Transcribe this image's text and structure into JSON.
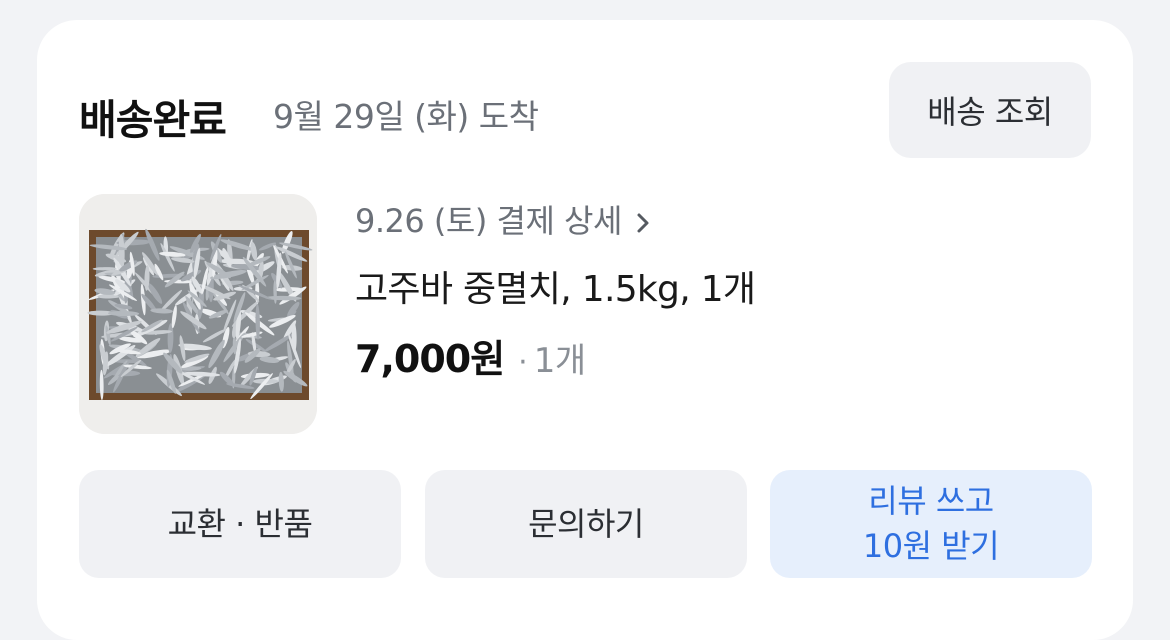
{
  "order": {
    "status": "배송완료",
    "arrival": "9월 29일 (화) 도착",
    "track_button": "배송 조회",
    "payment_detail_link": "9.26 (토) 결제 상세",
    "product_name": "고주바 중멸치, 1.5kg, 1개",
    "price": "7,000원",
    "separator": "·",
    "quantity": "1개"
  },
  "actions": {
    "exchange_return": "교환 · 반품",
    "inquiry": "문의하기",
    "review_line1": "리뷰 쓰고",
    "review_line2": "10원 받기"
  },
  "icons": {
    "payment_detail": "chevron-right-icon",
    "product_image": "dried-anchovies-in-wooden-box"
  },
  "colors": {
    "page_background": "#f2f3f6",
    "card_background": "#ffffff",
    "button_background": "#f0f1f4",
    "review_button_background": "#e6effc",
    "review_button_text": "#2e6fe0",
    "secondary_text": "#6b7078"
  }
}
